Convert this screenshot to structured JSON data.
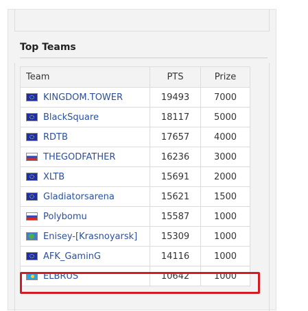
{
  "section": {
    "title": "Top Teams"
  },
  "table": {
    "headers": {
      "team": "Team",
      "pts": "PTS",
      "prize": "Prize"
    },
    "rows": [
      {
        "team": "KINGDOM.TOWER",
        "flag": "eu-flag-icon",
        "pts": "19493",
        "prize": "7000"
      },
      {
        "team": "BlackSquare",
        "flag": "eu-flag-icon",
        "pts": "18117",
        "prize": "5000"
      },
      {
        "team": "RDTB",
        "flag": "eu-flag-icon",
        "pts": "17657",
        "prize": "4000"
      },
      {
        "team": "THEGODFATHER",
        "flag": "russia-flag-icon",
        "pts": "16236",
        "prize": "3000"
      },
      {
        "team": "XLTB",
        "flag": "eu-flag-icon",
        "pts": "15691",
        "prize": "2000"
      },
      {
        "team": "Gladiatorsarena",
        "flag": "eu-flag-icon",
        "pts": "15621",
        "prize": "1500"
      },
      {
        "team": "Polybomu",
        "flag": "russia-flag-icon",
        "pts": "15587",
        "prize": "1000"
      },
      {
        "team": "Enisey-[Krasnoyarsk]",
        "flag": "world-flag-icon",
        "pts": "15309",
        "prize": "1000"
      },
      {
        "team": "AFK_GaminG",
        "flag": "eu-flag-icon",
        "pts": "14116",
        "prize": "1000"
      },
      {
        "team": "ELBRUS",
        "flag": "kazakhstan-flag-icon",
        "pts": "10642",
        "prize": "1000"
      }
    ]
  },
  "colors": {
    "link": "#2a4f9e",
    "highlight": "#d21c24",
    "panel": "#f3f3f3"
  }
}
